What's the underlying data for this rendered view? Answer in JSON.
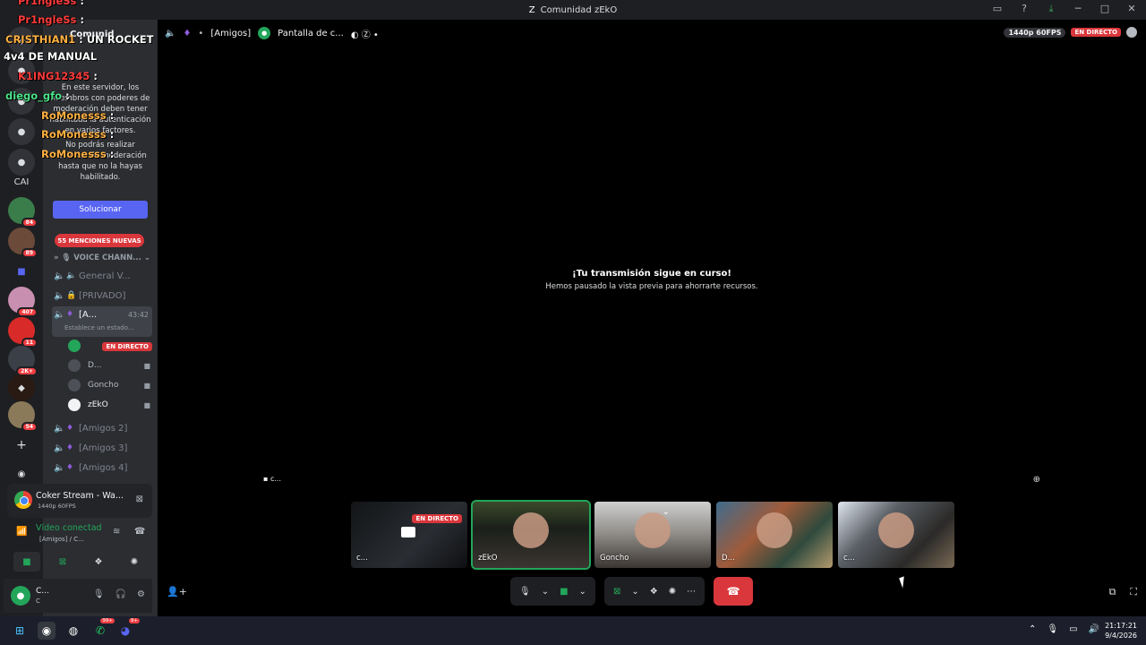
{
  "window": {
    "title": "Comunidad zEkO"
  },
  "server": {
    "name": "Comunid"
  },
  "chat_overlay": [
    {
      "user": "Pr1ngleSs",
      "sep": ":"
    },
    {
      "user": "Pr1ngleSs",
      "sep": ":"
    },
    {
      "user": "CRISTHIAN1",
      "sep": ":",
      "text": "UN ROCKET"
    },
    {
      "text": "4v4 DE MANUAL"
    },
    {
      "user": "K1ING12345",
      "sep": ":"
    },
    {
      "user": "diego_gfo",
      "sep": ":"
    },
    {
      "user": "RoMonesss",
      "sep": ":"
    },
    {
      "user": "RoMonesss",
      "sep": ":"
    },
    {
      "user": "RoMonesss",
      "sep": ":"
    }
  ],
  "moderation": {
    "text1": "En este servidor, los miembros con poderes de moderación deben tener habilitada la autenticación en varios factores.",
    "text2": "No podrás realizar acciones de moderación hasta que no la hayas habilitado.",
    "button": "Solucionar"
  },
  "mentions_banner": "55 MENCIONES NUEVAS",
  "voice_category": "VOICE CHANN...",
  "channels": [
    {
      "name": "General V..."
    },
    {
      "name": "[PRIVADO]"
    },
    {
      "name": "[A...",
      "timer": "43:42",
      "status": "Establece un estado..."
    },
    {
      "name": "[Amigos 2]"
    },
    {
      "name": "[Amigos 3]"
    },
    {
      "name": "[Amigos 4]"
    }
  ],
  "voice_users": [
    {
      "name": "",
      "badge": "EN DIRECTO"
    },
    {
      "name": "D..."
    },
    {
      "name": "Goncho"
    },
    {
      "name": "zEkO"
    }
  ],
  "server_badges": [
    "84",
    "89",
    "407",
    "11",
    "2K+",
    "54"
  ],
  "server_labels": [
    "CAI"
  ],
  "stream_card": {
    "title": "Coker Stream - Wa...",
    "sub": "1440p 60FPS"
  },
  "voice_connection": {
    "title": "Vídeo conectad",
    "sub": "[Amigos] / C..."
  },
  "user_bar": {
    "name": "C...",
    "status": "C"
  },
  "stage": {
    "channel": "[Amigos]",
    "screen": "Pantalla de c...",
    "quality": "1440p 60FPS",
    "live": "EN DIRECTO",
    "message_title": "¡Tu transmisión sigue en curso!",
    "message_sub": "Hemos pausado la vista previa para ahorrarte recursos.",
    "pip_label": "c..."
  },
  "tiles": [
    {
      "label": "c...",
      "badge": "EN DIRECTO"
    },
    {
      "label": "zEkO"
    },
    {
      "label": "Goncho"
    },
    {
      "label": "D..."
    },
    {
      "label": "c..."
    }
  ],
  "taskbar": {
    "time": "21:17:21",
    "date": "9/4/2026",
    "badges": [
      "99+",
      "9+"
    ]
  }
}
